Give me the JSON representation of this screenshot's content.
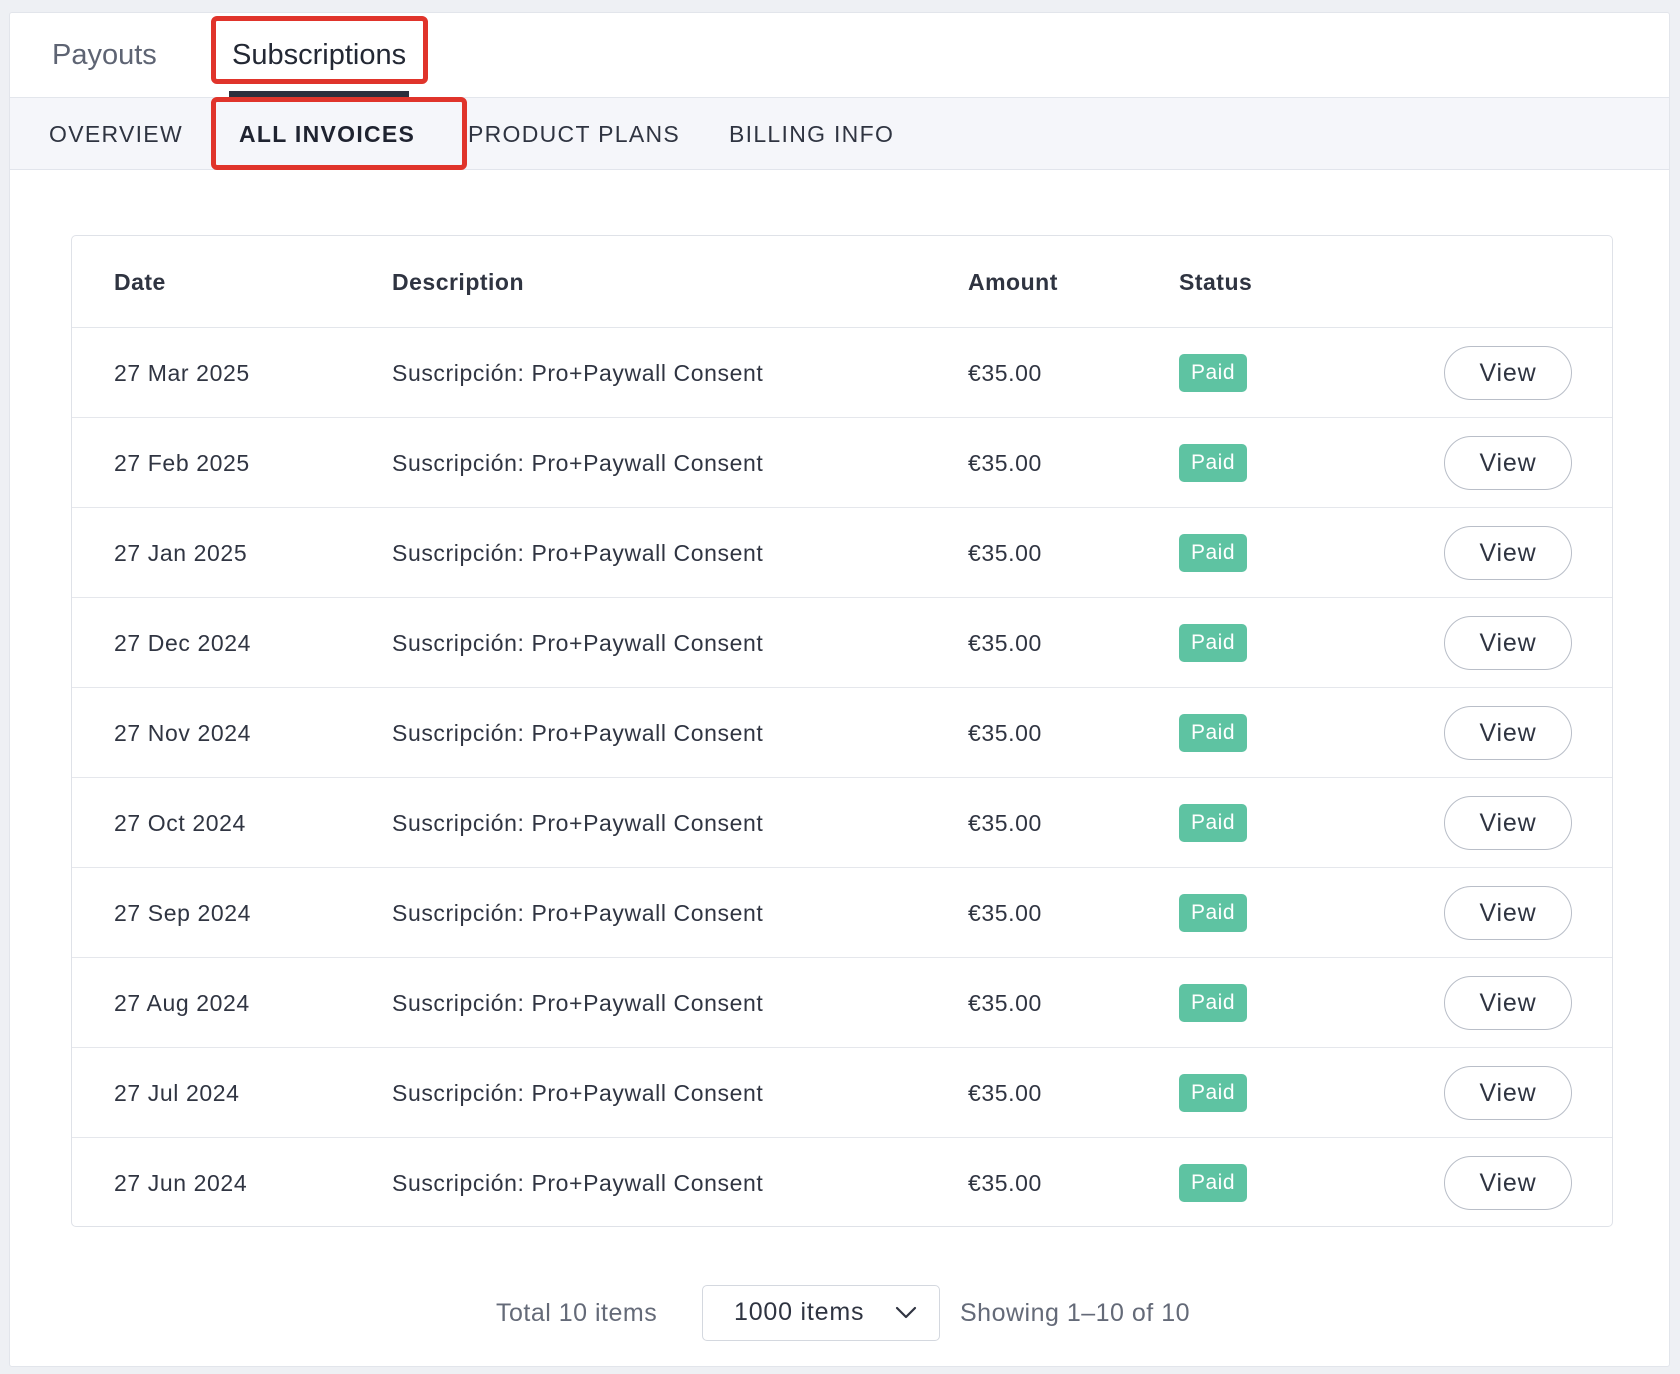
{
  "top_tabs": [
    {
      "label": "Payouts",
      "active": false
    },
    {
      "label": "Subscriptions",
      "active": true
    }
  ],
  "sub_tabs": [
    {
      "label": "OVERVIEW",
      "active": false
    },
    {
      "label": "ALL INVOICES",
      "active": true
    },
    {
      "label": "PRODUCT PLANS",
      "active": false
    },
    {
      "label": "BILLING INFO",
      "active": false
    }
  ],
  "table": {
    "headers": {
      "date": "Date",
      "description": "Description",
      "amount": "Amount",
      "status": "Status"
    },
    "rows": [
      {
        "date": "27 Mar 2025",
        "description": "Suscripción: Pro+Paywall Consent",
        "amount": "€35.00",
        "status": "Paid",
        "action": "View"
      },
      {
        "date": "27 Feb 2025",
        "description": "Suscripción: Pro+Paywall Consent",
        "amount": "€35.00",
        "status": "Paid",
        "action": "View"
      },
      {
        "date": "27 Jan 2025",
        "description": "Suscripción: Pro+Paywall Consent",
        "amount": "€35.00",
        "status": "Paid",
        "action": "View"
      },
      {
        "date": "27 Dec 2024",
        "description": "Suscripción: Pro+Paywall Consent",
        "amount": "€35.00",
        "status": "Paid",
        "action": "View"
      },
      {
        "date": "27 Nov 2024",
        "description": "Suscripción: Pro+Paywall Consent",
        "amount": "€35.00",
        "status": "Paid",
        "action": "View"
      },
      {
        "date": "27 Oct 2024",
        "description": "Suscripción: Pro+Paywall Consent",
        "amount": "€35.00",
        "status": "Paid",
        "action": "View"
      },
      {
        "date": "27 Sep 2024",
        "description": "Suscripción: Pro+Paywall Consent",
        "amount": "€35.00",
        "status": "Paid",
        "action": "View"
      },
      {
        "date": "27 Aug 2024",
        "description": "Suscripción: Pro+Paywall Consent",
        "amount": "€35.00",
        "status": "Paid",
        "action": "View"
      },
      {
        "date": "27 Jul 2024",
        "description": "Suscripción: Pro+Paywall Consent",
        "amount": "€35.00",
        "status": "Paid",
        "action": "View"
      },
      {
        "date": "27 Jun 2024",
        "description": "Suscripción: Pro+Paywall Consent",
        "amount": "€35.00",
        "status": "Paid",
        "action": "View"
      }
    ]
  },
  "pagination": {
    "total_label": "Total 10 items",
    "page_size_value": "1000 items",
    "page_size_icon": "chevron-down-icon",
    "showing_label": "Showing 1–10 of 10"
  },
  "colors": {
    "paid_badge": "#5ec3a2",
    "highlight_box": "#e0342b",
    "active_tab_underline": "#2d2f3c"
  }
}
